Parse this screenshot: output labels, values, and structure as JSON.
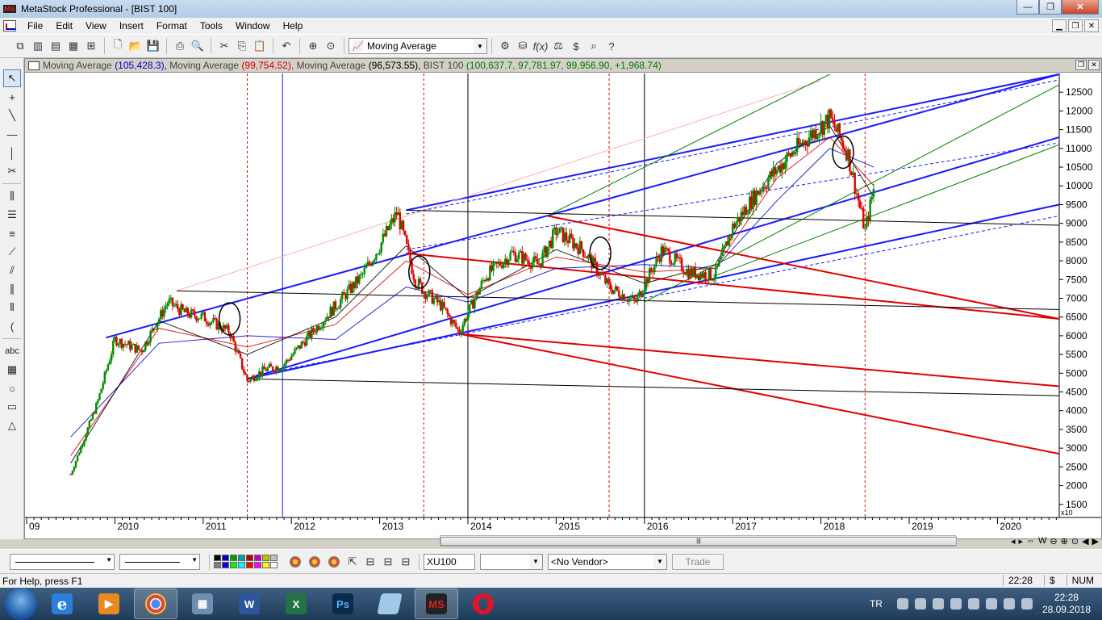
{
  "window": {
    "title": "MetaStock Professional - [BIST 100]",
    "controls": {
      "minimize": "—",
      "maximize": "❐",
      "close": "✕"
    }
  },
  "menu": {
    "items": [
      "File",
      "Edit",
      "View",
      "Insert",
      "Format",
      "Tools",
      "Window",
      "Help"
    ]
  },
  "toolbar": {
    "indicator_combo": "Moving Average"
  },
  "chart_header": {
    "ma1_label": "Moving Average",
    "ma1_value": "(105,428.3),",
    "ma2_label": "Moving Average",
    "ma2_value": "(99,754.52),",
    "ma3_label": "Moving Average",
    "ma3_value": "(96,573.55),",
    "symbol_label": "BIST 100",
    "symbol_value": "(100,637.7, 97,781.97, 99,956.90, +1,968.74)"
  },
  "chart_data": {
    "type": "line",
    "x_tick_labels": [
      "09",
      "2010",
      "2011",
      "2012",
      "2013",
      "2014",
      "2015",
      "2016",
      "2017",
      "2018",
      "2019",
      "2020"
    ],
    "y_tick_labels": [
      "12500",
      "12000",
      "11500",
      "11000",
      "10500",
      "10000",
      "9500",
      "9000",
      "8500",
      "8000",
      "7500",
      "7000",
      "6500",
      "6000",
      "5500",
      "5000",
      "4500",
      "4000",
      "3500",
      "3000",
      "2500",
      "2000",
      "1500"
    ],
    "y_multiplier": "x10",
    "ylim": [
      1500,
      12500
    ],
    "series": [
      {
        "name": "BIST 100",
        "x": [
          2009.5,
          2009.8,
          2010.0,
          2010.3,
          2010.6,
          2010.8,
          2011.0,
          2011.3,
          2011.5,
          2011.7,
          2011.9,
          2012.2,
          2012.5,
          2012.8,
          2013.0,
          2013.2,
          2013.4,
          2013.5,
          2013.7,
          2013.9,
          2014.2,
          2014.5,
          2014.8,
          2015.0,
          2015.3,
          2015.6,
          2015.9,
          2016.2,
          2016.5,
          2016.8,
          2017.0,
          2017.3,
          2017.6,
          2017.9,
          2018.1,
          2018.3,
          2018.5,
          2018.6
        ],
        "y": [
          2300,
          4200,
          5900,
          5600,
          6900,
          6600,
          6500,
          6100,
          4800,
          5100,
          5200,
          6000,
          6800,
          7600,
          8400,
          9300,
          7500,
          7200,
          6800,
          6100,
          7600,
          8200,
          7900,
          8800,
          8300,
          7300,
          6900,
          8300,
          7700,
          7600,
          8900,
          9900,
          10700,
          11400,
          11800,
          10900,
          8800,
          9950
        ]
      },
      {
        "name": "Moving Average (105,428.3)",
        "x": [
          2009.5,
          2010.5,
          2011.5,
          2012.5,
          2013.3,
          2014.0,
          2015.0,
          2016.0,
          2016.8,
          2017.5,
          2018.1,
          2018.6
        ],
        "y": [
          3300,
          5800,
          6000,
          5900,
          7300,
          6900,
          7800,
          7900,
          7800,
          9600,
          11000,
          10500
        ]
      },
      {
        "name": "Moving Average (99,754.52)",
        "x": [
          2009.5,
          2010.5,
          2011.5,
          2012.5,
          2013.3,
          2014.0,
          2015.0,
          2016.0,
          2016.8,
          2017.5,
          2018.1,
          2018.6
        ],
        "y": [
          2800,
          6200,
          5700,
          6300,
          8000,
          7100,
          8100,
          7700,
          7800,
          10200,
          11300,
          10000
        ]
      },
      {
        "name": "Moving Average (96,573.55)",
        "x": [
          2009.5,
          2010.5,
          2011.5,
          2012.5,
          2013.3,
          2014.0,
          2015.0,
          2016.0,
          2016.8,
          2017.5,
          2018.1,
          2018.6
        ],
        "y": [
          2600,
          6400,
          5500,
          6500,
          8400,
          7000,
          8300,
          7400,
          7900,
          10600,
          11600,
          9700
        ]
      }
    ],
    "trendlines": [
      {
        "color": "#1a1aff",
        "from": [
          2009.9,
          5950
        ],
        "to": [
          2020.7,
          12980
        ]
      },
      {
        "color": "#1a1aff",
        "from": [
          2011.5,
          4850
        ],
        "to": [
          2020.7,
          11300
        ]
      },
      {
        "color": "#1a1aff",
        "from": [
          2011.5,
          4850
        ],
        "to": [
          2020.7,
          9500
        ]
      },
      {
        "color": "#1a1aff",
        "from": [
          2013.3,
          9350
        ],
        "to": [
          2020.7,
          12980
        ]
      },
      {
        "color": "#e00000",
        "from": [
          2013.3,
          8200
        ],
        "to": [
          2020.7,
          6450
        ]
      },
      {
        "color": "#e00000",
        "from": [
          2013.9,
          6050
        ],
        "to": [
          2020.7,
          4650
        ]
      },
      {
        "color": "#e00000",
        "from": [
          2013.9,
          6050
        ],
        "to": [
          2020.7,
          2850
        ]
      },
      {
        "color": "#e00000",
        "from": [
          2014.9,
          9200
        ],
        "to": [
          2020.7,
          6450
        ]
      },
      {
        "color": "#ffb0b0",
        "from": [
          2010.7,
          7200
        ],
        "to": [
          2018.0,
          12800
        ]
      },
      {
        "color": "#000000",
        "from": [
          2010.7,
          7200
        ],
        "to": [
          2020.7,
          6700
        ]
      },
      {
        "color": "#000000",
        "from": [
          2011.5,
          4850
        ],
        "to": [
          2020.7,
          4400
        ]
      },
      {
        "color": "#000000",
        "from": [
          2013.3,
          9350
        ],
        "to": [
          2020.7,
          8950
        ]
      },
      {
        "color": "#008000",
        "from": [
          2014.9,
          9200
        ],
        "to": [
          2018.1,
          12980
        ]
      },
      {
        "color": "#008000",
        "from": [
          2016.0,
          6900
        ],
        "to": [
          2020.7,
          12700
        ]
      },
      {
        "color": "#008000",
        "from": [
          2016.8,
          7600
        ],
        "to": [
          2020.7,
          11100
        ]
      }
    ],
    "vertical_lines": [
      {
        "x": 2011.5,
        "style": "dashed",
        "color": "#e00000"
      },
      {
        "x": 2011.9,
        "style": "solid",
        "color": "#1a1aff"
      },
      {
        "x": 2013.5,
        "style": "dashed",
        "color": "#e00000"
      },
      {
        "x": 2014.0,
        "style": "solid",
        "color": "#000000"
      },
      {
        "x": 2015.6,
        "style": "dashed",
        "color": "#e00000"
      },
      {
        "x": 2016.0,
        "style": "solid",
        "color": "#000000"
      },
      {
        "x": 2018.5,
        "style": "dashed",
        "color": "#e00000"
      }
    ],
    "circles": [
      {
        "x": 2011.3,
        "y": 6450
      },
      {
        "x": 2013.45,
        "y": 7700
      },
      {
        "x": 2015.5,
        "y": 8200
      },
      {
        "x": 2018.25,
        "y": 10900
      }
    ]
  },
  "bottom_toolbar": {
    "symbol_field": "XU100",
    "empty_combo": "",
    "vendor_combo": "<No Vendor>",
    "trade_button": "Trade",
    "swatch_colors": [
      "#000000",
      "#0000c0",
      "#00a000",
      "#00a0a0",
      "#c00000",
      "#c000c0",
      "#c0c000",
      "#c0c0c0",
      "#808080",
      "#0000ff",
      "#00ff00",
      "#00ffff",
      "#ff0000",
      "#ff00ff",
      "#ffff00",
      "#ffffff"
    ]
  },
  "statusbar": {
    "help_text": "For Help, press F1",
    "time": "22:28",
    "currency": "$",
    "num": "NUM"
  },
  "taskbar": {
    "lang": "TR",
    "clock_time": "22:28",
    "clock_date": "28.09.2018",
    "apps": [
      "ie",
      "media",
      "chrome",
      "calculator",
      "word",
      "excel",
      "photoshop",
      "notes",
      "metastock",
      "opera"
    ]
  }
}
